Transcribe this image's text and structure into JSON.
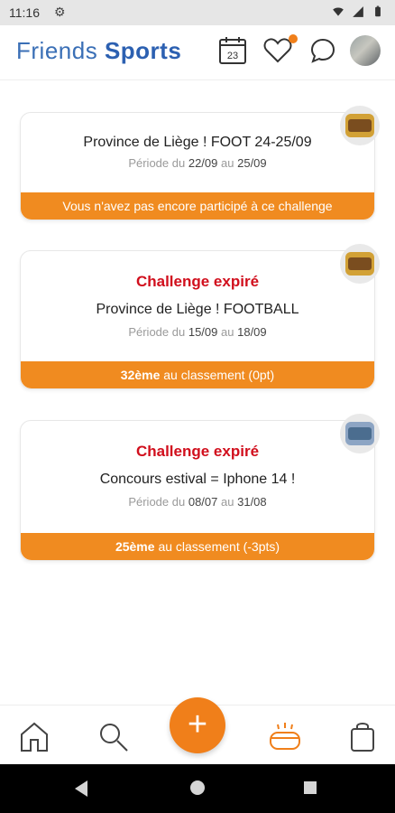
{
  "status_bar": {
    "time": "11:16"
  },
  "header": {
    "brand_friends": "Friends",
    "brand_sports": "Sports",
    "calendar_day": "23"
  },
  "challenges": [
    {
      "title": "Province de Liège ! FOOT 24-25/09",
      "period_prefix": "Période du",
      "period_start": "22/09",
      "period_mid": "au",
      "period_end": "25/09",
      "footer": "Vous n'avez pas encore participé à ce challenge"
    },
    {
      "status": "Challenge expiré",
      "title": "Province de Liège ! FOOTBALL",
      "period_prefix": "Période du",
      "period_start": "15/09",
      "period_mid": "au",
      "period_end": "18/09",
      "rank": "32ème",
      "rank_suffix": "au classement (0pt)"
    },
    {
      "status": "Challenge expiré",
      "title": "Concours estival = Iphone 14 !",
      "period_prefix": "Période du",
      "period_start": "08/07",
      "period_mid": "au",
      "period_end": "31/08",
      "rank": "25ème",
      "rank_suffix": "au classement (-3pts)"
    }
  ],
  "bottom_nav": {
    "add_label": "+"
  },
  "colors": {
    "accent": "#f07f1a",
    "brand_blue": "#2c60b1",
    "expired_red": "#d10f1d"
  }
}
